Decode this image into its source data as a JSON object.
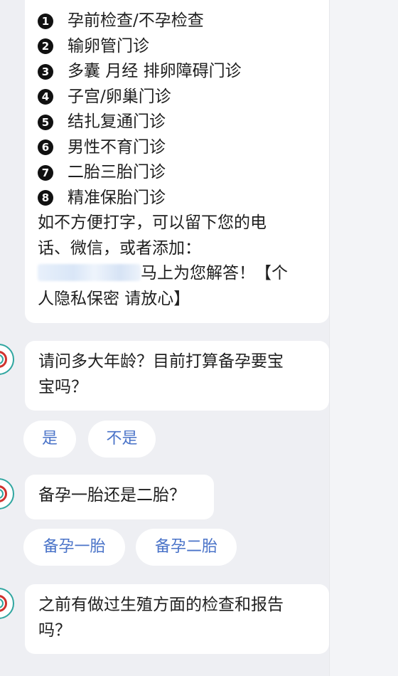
{
  "intro_card": {
    "services": [
      {
        "num": "1",
        "label": "孕前检查/不孕检查"
      },
      {
        "num": "2",
        "label": "输卵管门诊"
      },
      {
        "num": "3",
        "label": "多囊 月经 排卵障碍门诊"
      },
      {
        "num": "4",
        "label": "子宫/卵巢门诊"
      },
      {
        "num": "5",
        "label": "结扎复通门诊"
      },
      {
        "num": "6",
        "label": "男性不育门诊"
      },
      {
        "num": "7",
        "label": "二胎三胎门诊"
      },
      {
        "num": "8",
        "label": "精准保胎门诊"
      }
    ],
    "contact_line1": "如不方便打字，可以留下您的电",
    "contact_line2": "话、微信，或者添加：",
    "contact_line3_suffix": "马上为您解答！【个",
    "contact_line4": "人隐私保密  请放心】"
  },
  "messages": [
    {
      "line1": "请问多大年龄？目前打算备孕要宝",
      "line2": "宝吗？"
    },
    {
      "line1": "备孕一胎还是二胎？"
    },
    {
      "line1": "之前有做过生殖方面的检查和报告",
      "line2": "吗？"
    }
  ],
  "quick_replies_1": [
    "是",
    "不是"
  ],
  "quick_replies_2": [
    "备孕一胎",
    "备孕二胎"
  ],
  "colors": {
    "background": "#eeeff3",
    "bubble": "#ffffff",
    "chip_text": "#4a73c8",
    "avatar_ring": "#2fa6a0",
    "avatar_mark": "#d0332f"
  },
  "icons": {
    "bot_avatar": "hospital-logo-icon",
    "number_markers": "dingbat-negative-circled-digit"
  }
}
